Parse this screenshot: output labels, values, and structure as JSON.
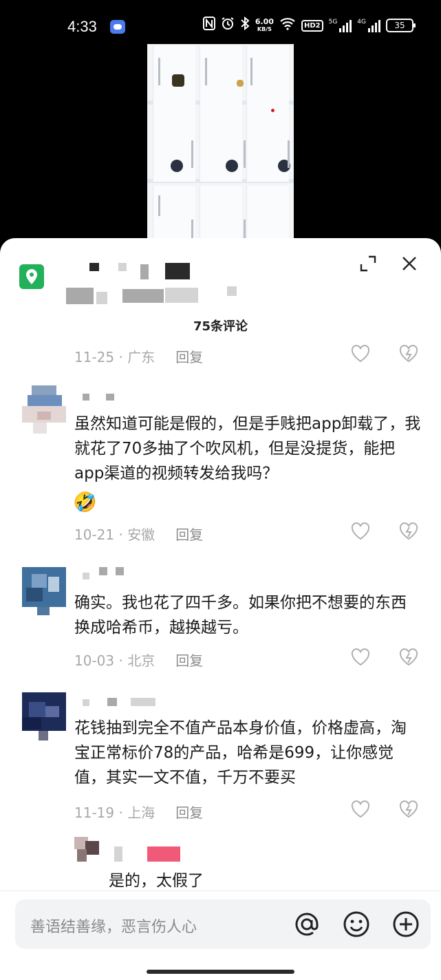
{
  "status_bar": {
    "time": "4:33",
    "net_speed_value": "6.00",
    "net_speed_unit": "KB/S",
    "hd": "HD2",
    "signal1": "5G",
    "signal2": "4G",
    "battery": "35"
  },
  "sheet": {
    "comment_count": "75条评论"
  },
  "comments": [
    {
      "date_loc": "11-25 · 广东",
      "reply": "回复"
    },
    {
      "text": "虽然知道可能是假的，但是手贱把app卸载了，我就花了70多抽了个吹风机，但是没提货，能把app渠道的视频转发给我吗？",
      "emoji": "🤣",
      "date_loc": "10-21 · 安徽",
      "reply": "回复"
    },
    {
      "text": "确实。我也花了四千多。如果你把不想要的东西换成哈希币，越换越亏。",
      "date_loc": "10-03 · 北京",
      "reply": "回复"
    },
    {
      "text": "花钱抽到完全不值产品本身价值，价格虚高，淘宝正常标价78的产品，哈希是699，让你感觉值，其实一文不值，千万不要买",
      "date_loc": "11-19 · 上海",
      "reply": "回复"
    }
  ],
  "sub_reply": {
    "text": "是的，太假了"
  },
  "input": {
    "placeholder": "善语结善缘，恶言伤人心"
  },
  "colors": {
    "location_pin": "#22b05a",
    "reply_tag": "#f05a78"
  }
}
